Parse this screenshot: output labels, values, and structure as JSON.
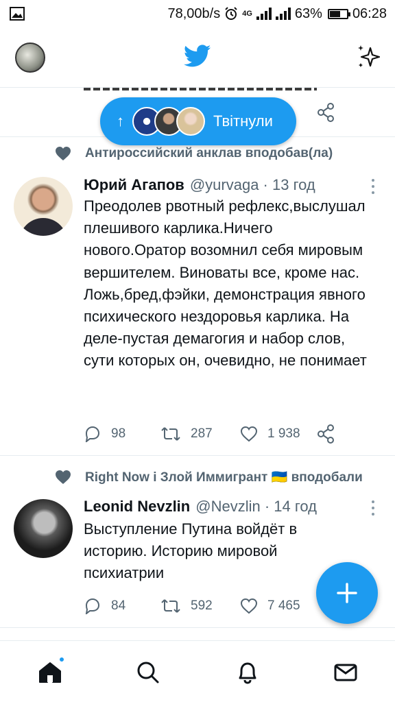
{
  "status_bar": {
    "speed": "78,00b/s",
    "network": "4G",
    "battery_percent": "63%",
    "battery_level": 0.63,
    "time": "06:28"
  },
  "pill": {
    "label": "Твітнули"
  },
  "tweets": [
    {
      "social_context": "Антироссийский анклав вподобав(ла)",
      "name": "Юрий Агапов",
      "handle": "@yurvaga",
      "time": "13 год",
      "text": "Преодолев рвотный рефлекс,выслушал плешивого карлика.Ничего нового.Оратор возомнил себя мировым вершителем. Виноваты все, кроме нас. Ложь,бред,фэйки, демонстрация явного психического нездоровья карлика. На деле-пустая демагогия и набор слов, сути которых он, очевидно, не понимает",
      "replies": "98",
      "retweets": "287",
      "likes": "1 938"
    },
    {
      "social_context": "Right Now і Злой Иммигрант 🇺🇦 вподобали",
      "name": "Leonid Nevzlin",
      "handle": "@Nevzlin",
      "time": "14 год",
      "text": "Выступление Путина войдёт в историю. Историю мировой психиатрии",
      "replies": "84",
      "retweets": "592",
      "likes": "7 465"
    }
  ],
  "icons": {
    "header_left": "profile-avatar",
    "header_center": "twitter-bird-icon",
    "header_right": "sparkle-icon",
    "fab": "compose-plus-icon",
    "nav": [
      "home-icon",
      "search-icon",
      "notifications-bell-icon",
      "messages-mail-icon"
    ]
  },
  "colors": {
    "accent": "#1d9bf0",
    "secondary_text": "#536471",
    "border": "#e6ecf0"
  }
}
